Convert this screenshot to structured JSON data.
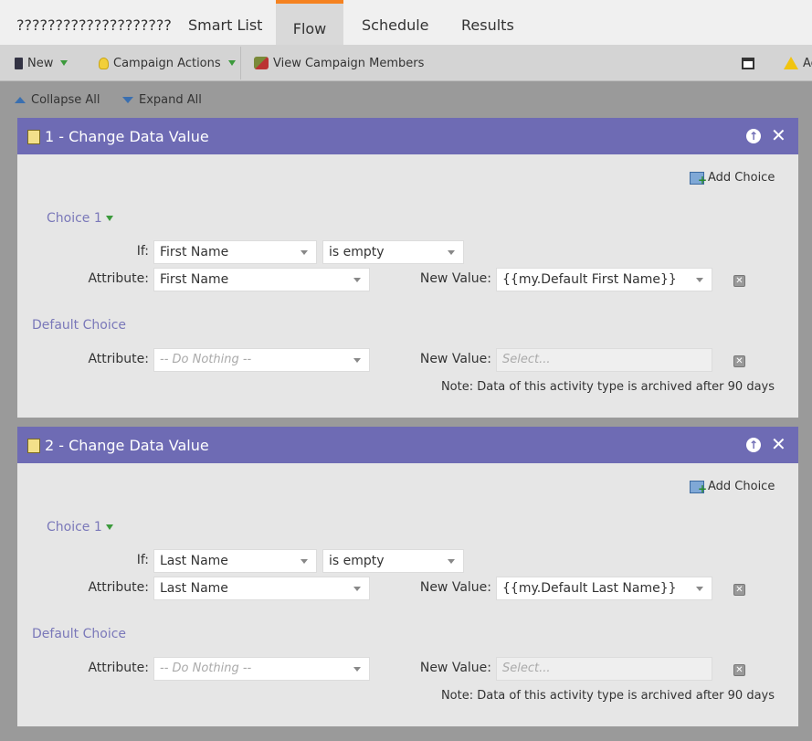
{
  "tabs": {
    "title": "????????????????????",
    "smart_list": "Smart List",
    "flow": "Flow",
    "schedule": "Schedule",
    "results": "Results"
  },
  "toolbar": {
    "new_label": "New",
    "actions_label": "Campaign Actions",
    "members_label": "View Campaign Members",
    "warn_label": "Ac"
  },
  "expand": {
    "collapse_label": "Collapse All",
    "expand_label": "Expand All"
  },
  "steps": [
    {
      "title": "1 - Change Data Value",
      "add_choice": "Add Choice",
      "choice_label": "Choice 1",
      "if_label": "If:",
      "if_field": "First Name",
      "if_operator": "is empty",
      "attribute_label": "Attribute:",
      "attribute_value": "First Name",
      "new_value_label": "New Value:",
      "new_value": "{{my.Default First Name}}",
      "default_label": "Default Choice",
      "default_attribute": "-- Do Nothing --",
      "default_new_value_placeholder": "Select...",
      "note": "Note: Data of this activity type is archived after 90 days"
    },
    {
      "title": "2 - Change Data Value",
      "add_choice": "Add Choice",
      "choice_label": "Choice 1",
      "if_label": "If:",
      "if_field": "Last Name",
      "if_operator": "is empty",
      "attribute_label": "Attribute:",
      "attribute_value": "Last Name",
      "new_value_label": "New Value:",
      "new_value": "{{my.Default Last Name}}",
      "default_label": "Default Choice",
      "default_attribute": "-- Do Nothing --",
      "default_new_value_placeholder": "Select...",
      "note": "Note: Data of this activity type is archived after 90 days"
    }
  ],
  "colors": {
    "accent": "#f58220",
    "step_header": "#6e6bb4",
    "choice_text": "#7a78b9"
  }
}
